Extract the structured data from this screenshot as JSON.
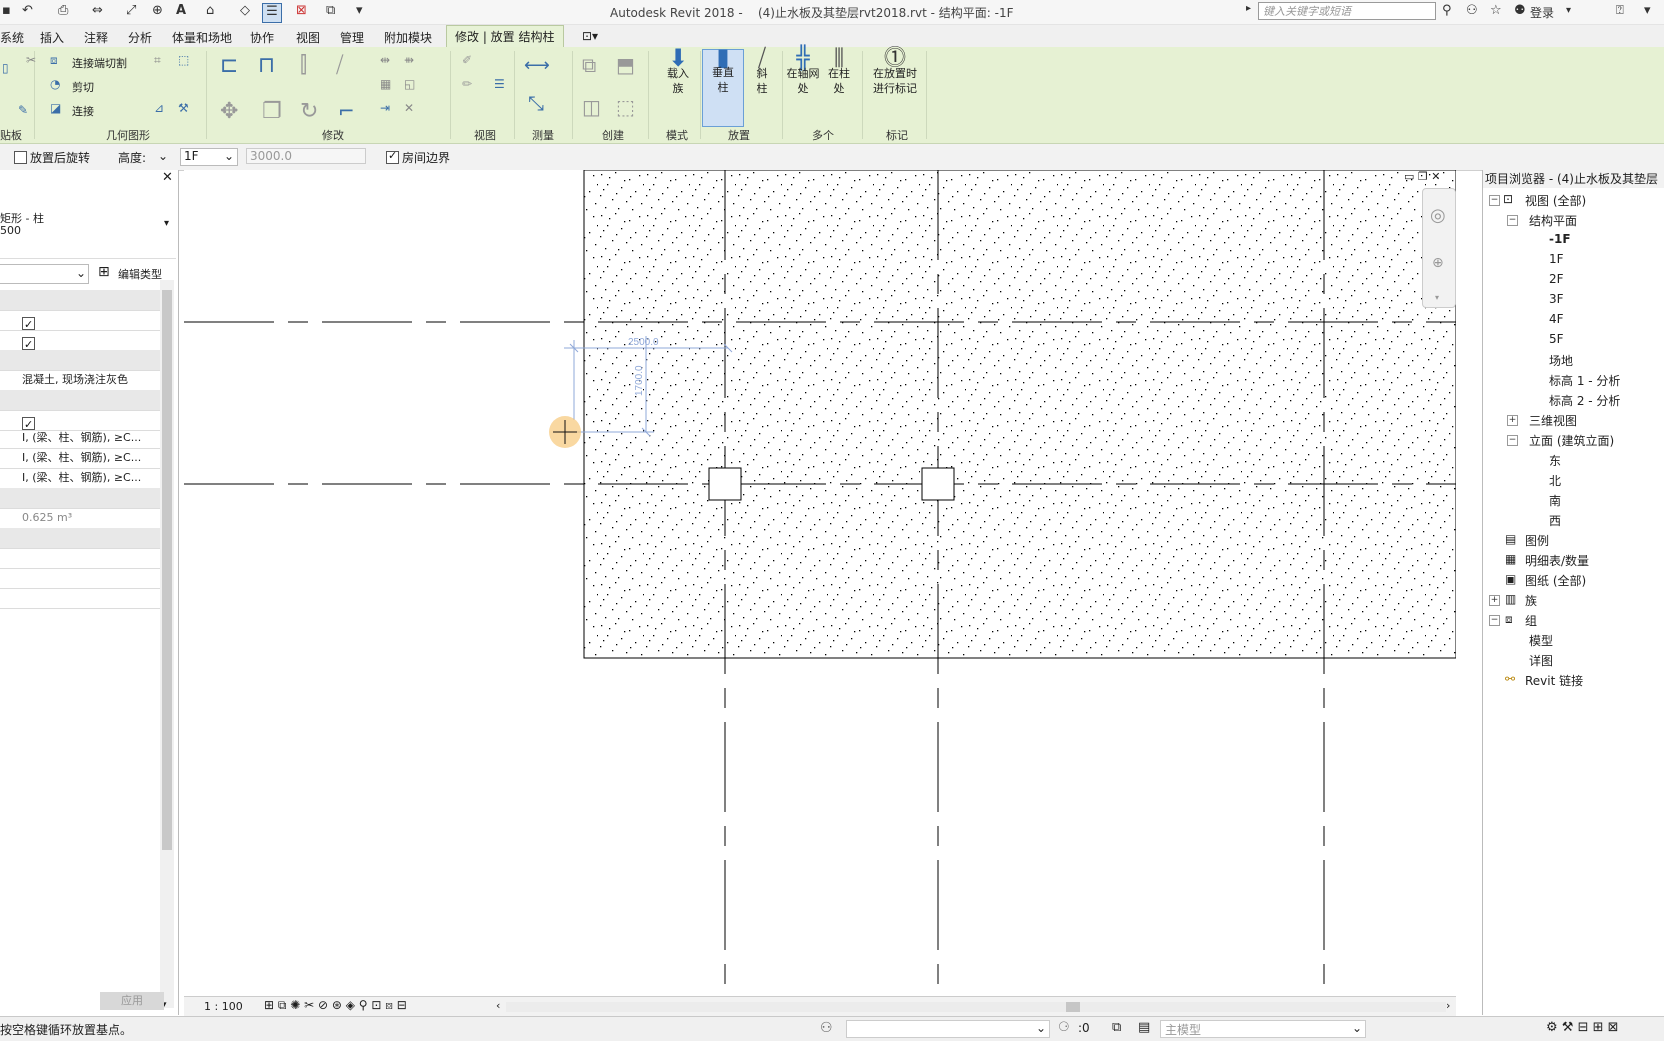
{
  "app": {
    "title": "Autodesk Revit 2018 -",
    "document": "(4)止水板及其垫层rvt2018.rvt - 结构平面: -1F",
    "search_placeholder": "键入关键字或短语",
    "login": "登录"
  },
  "tabs": [
    "系统",
    "插入",
    "注释",
    "分析",
    "体量和场地",
    "协作",
    "视图",
    "管理",
    "附加模块",
    "修改 | 放置 结构柱"
  ],
  "ribbon": {
    "clipboard_label": "贴板",
    "geometry": {
      "items": [
        "连接端切割",
        "剪切",
        "连接"
      ],
      "label": "几何图形"
    },
    "modify_label": "修改",
    "view_label": "视图",
    "measure_label": "测量",
    "create_label": "创建",
    "mode": {
      "button": "载入族",
      "label": "模式"
    },
    "placement": {
      "vertical": "垂直柱",
      "slanted": "斜柱",
      "label": "放置"
    },
    "multiple": {
      "at_grids": "在轴网处",
      "at_columns": "在柱处",
      "label": "多个"
    },
    "tag": {
      "button": "在放置时进行标记",
      "label": "标记"
    }
  },
  "options_bar": {
    "rotate_after": "放置后旋转",
    "height_label": "高度:",
    "level": "1F",
    "height_value": "3000.0",
    "room_bounding": "房间边界"
  },
  "properties": {
    "type_line1": "矩形 - 柱",
    "type_line2": "500",
    "edit_type": "编辑类型",
    "material": "混凝土, 现场浇注灰色",
    "rebar_rows": [
      "I, (梁、柱、钢筋), ≥C...",
      "I, (梁、柱、钢筋), ≥C...",
      "I, (梁、柱、钢筋), ≥C..."
    ],
    "volume": "0.625 m³",
    "apply": "应用"
  },
  "canvas": {
    "dim_horizontal": "2500.0",
    "dim_vertical": "1700.0"
  },
  "browser": {
    "title": "项目浏览器 - (4)止水板及其垫层",
    "views_all": "视图 (全部)",
    "structural_plans": "结构平面",
    "plans": [
      "-1F",
      "1F",
      "2F",
      "3F",
      "4F",
      "5F",
      "场地",
      "标高 1 - 分析",
      "标高 2 - 分析"
    ],
    "views_3d": "三维视图",
    "elevations": "立面 (建筑立面)",
    "elevation_items": [
      "东",
      "北",
      "南",
      "西"
    ],
    "legends": "图例",
    "schedules": "明细表/数量",
    "sheets": "图纸 (全部)",
    "families": "族",
    "groups": "组",
    "group_items": [
      "模型",
      "详图"
    ],
    "revit_links": "Revit 链接"
  },
  "view_bar": {
    "scale": "1 : 100"
  },
  "status": {
    "message": "按空格键循环放置基点。",
    "workset_value": ":0",
    "model": "主模型"
  }
}
